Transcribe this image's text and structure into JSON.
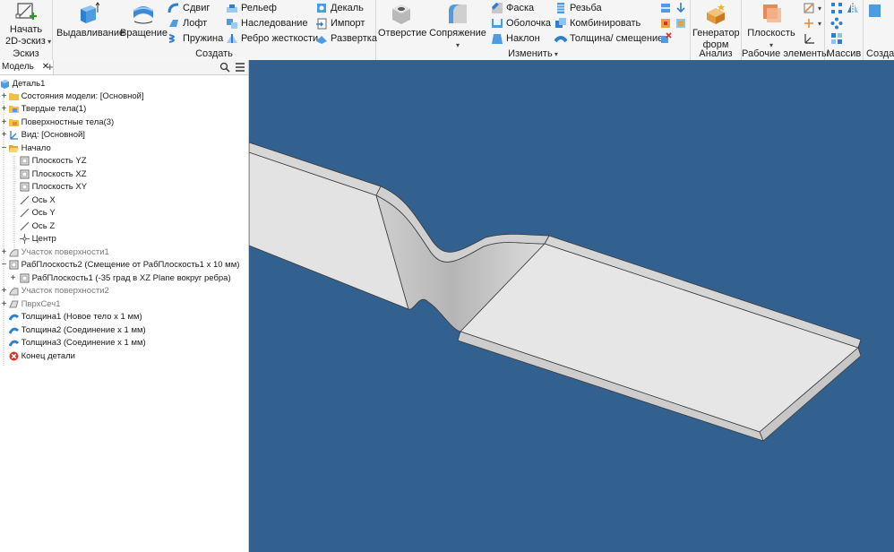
{
  "ribbon": {
    "sketch": {
      "start_label": "Начать",
      "start_label2": "2D-эскиз",
      "group": "Эскиз"
    },
    "create": {
      "extrude": "Выдавливание",
      "revolve": "Вращение",
      "sweep": "Сдвиг",
      "loft": "Лофт",
      "coil": "Пружина",
      "emboss": "Рельеф",
      "derive": "Наследование",
      "rib": "Ребро жесткости",
      "decal": "Декаль",
      "import": "Импорт",
      "unwrap": "Развертка",
      "group": "Создать"
    },
    "modify": {
      "hole": "Отверстие",
      "fillet": "Сопряжение",
      "chamfer": "Фаска",
      "shell": "Оболочка",
      "draft": "Наклон",
      "thread": "Резьба",
      "combine": "Комбинировать",
      "thicken": "Толщина/ смещение",
      "group": "Изменить"
    },
    "explore": {
      "shape_gen": "Генератор",
      "shape_gen2": "форм",
      "group": "Анализ"
    },
    "work_features": {
      "plane": "Плоскость",
      "group": "Рабочие элементы"
    },
    "pattern": {
      "group": "Массив"
    },
    "create_freeform": {
      "group": "Создан"
    }
  },
  "browser": {
    "tab_label": "Модель",
    "close": "✕",
    "add": "+",
    "items": [
      {
        "label": "Деталь1"
      },
      {
        "label": "Состояния модели: [Основной]"
      },
      {
        "label": "Твердые тела(1)"
      },
      {
        "label": "Поверхностные тела(3)"
      },
      {
        "label": "Вид: [Основной]"
      },
      {
        "label": "Начало"
      },
      {
        "label": "Плоскость YZ"
      },
      {
        "label": "Плоскость XZ"
      },
      {
        "label": "Плоскость XY"
      },
      {
        "label": "Ось X"
      },
      {
        "label": "Ось Y"
      },
      {
        "label": "Ось Z"
      },
      {
        "label": "Центр"
      },
      {
        "label": "Участок поверхности1"
      },
      {
        "label": "РабПлоскость2 (Смещение от РабПлоскость1 x 10 мм)"
      },
      {
        "label": "РабПлоскость1 (-35 град в XZ Plane вокруг ребра)"
      },
      {
        "label": "Участок поверхности2"
      },
      {
        "label": "ПврхСеч1"
      },
      {
        "label": "Толщина1 (Новое тело x 1 мм)"
      },
      {
        "label": "Толщина2 (Соединение x 1 мм)"
      },
      {
        "label": "Толщина3 (Соединение x 1 мм)"
      },
      {
        "label": "Конец детали"
      }
    ]
  },
  "colors": {
    "viewport_bg": "#33618f",
    "part_face": "#e2e2e2",
    "part_side": "#c9c9c9",
    "accent_blue": "#1f6fc5",
    "error_red": "#d8332b"
  }
}
